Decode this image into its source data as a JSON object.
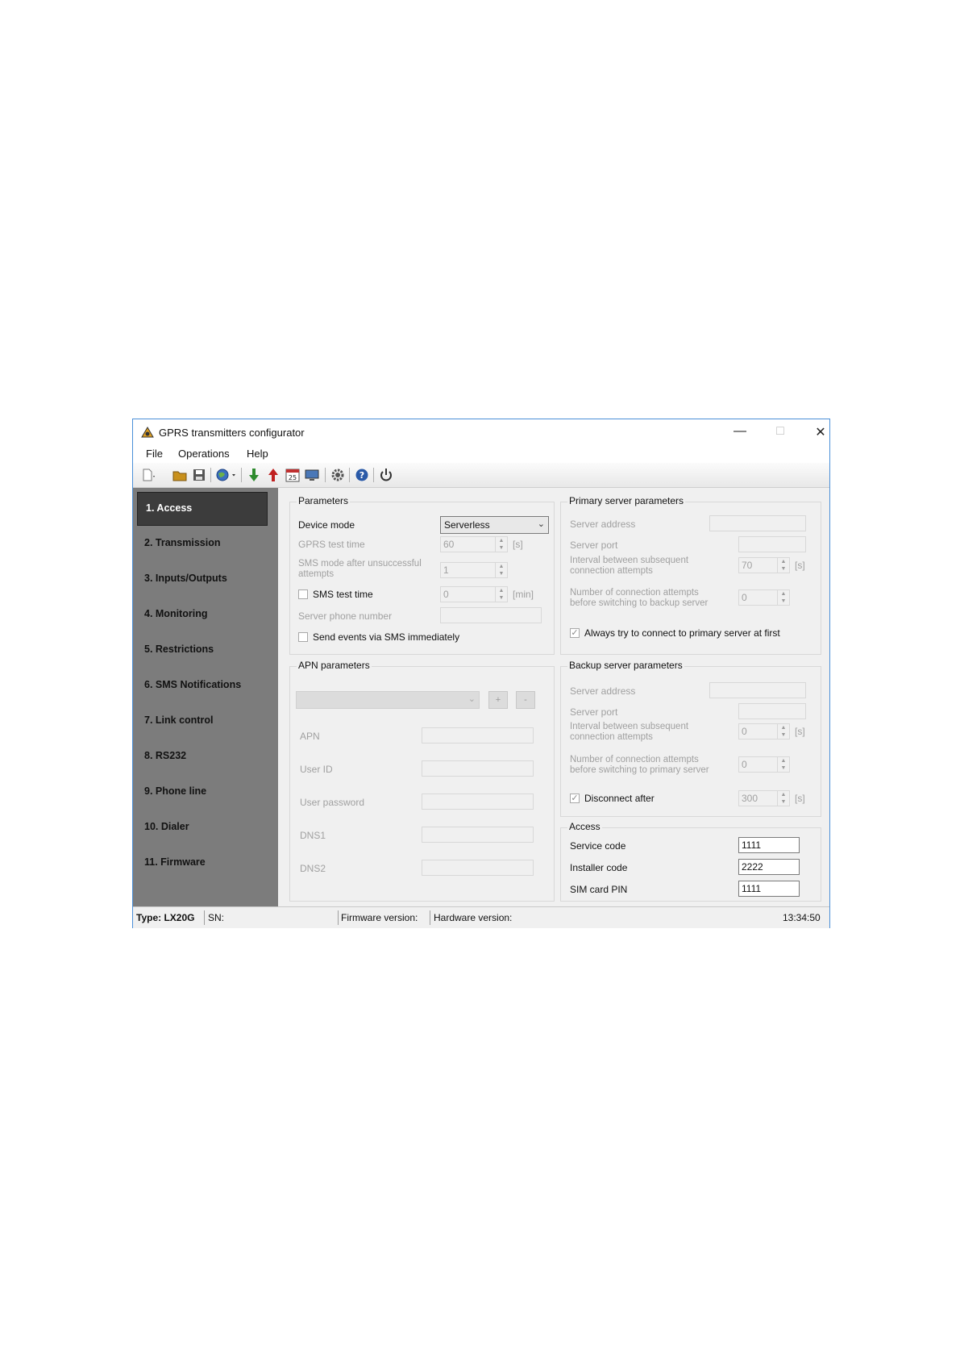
{
  "window": {
    "title": "GPRS transmitters configurator"
  },
  "menu": [
    "File",
    "Operations",
    "Help"
  ],
  "toolbar_icons": [
    "new-icon",
    "open-folder-icon",
    "save-icon",
    "globe-icon",
    "download-icon",
    "upload-icon",
    "calendar-icon",
    "monitor-icon",
    "gear-icon",
    "help-icon",
    "power-icon"
  ],
  "toolbar_calendar_day": "25",
  "sidebar": {
    "items": [
      "1. Access",
      "2. Transmission",
      "3. Inputs/Outputs",
      "4. Monitoring",
      "5. Restrictions",
      "6. SMS Notifications",
      "7. Link control",
      "8. RS232",
      "9. Phone line",
      "10. Dialer",
      "11. Firmware"
    ],
    "active": "1. Access"
  },
  "parameters": {
    "title": "Parameters",
    "device_mode_label": "Device mode",
    "device_mode_value": "Serverless",
    "gprs_test_time_label": "GPRS test time",
    "gprs_test_time_value": "60",
    "gprs_test_time_unit": "[s]",
    "sms_mode_label_1": "SMS mode after unsuccessful",
    "sms_mode_label_2": "attempts",
    "sms_mode_value": "1",
    "sms_test_time_label": "SMS test time",
    "sms_test_time_value": "0",
    "sms_test_time_unit": "[min]",
    "server_phone_label": "Server phone number",
    "server_phone_value": "",
    "send_events_label": "Send events via SMS immediately"
  },
  "apn": {
    "title": "APN parameters",
    "plus": "+",
    "minus": "-",
    "apn_label": "APN",
    "user_id_label": "User ID",
    "user_password_label": "User password",
    "dns1_label": "DNS1",
    "dns2_label": "DNS2"
  },
  "primary": {
    "title": "Primary server parameters",
    "server_address_label": "Server address",
    "server_port_label": "Server port",
    "interval_label_1": "Interval between subsequent",
    "interval_label_2": "connection attempts",
    "interval_value": "70",
    "interval_unit": "[s]",
    "attempts_label_1": "Number of connection attempts",
    "attempts_label_2": "before switching to backup server",
    "attempts_value": "0",
    "always_try_label": "Always try to connect to primary server at first"
  },
  "backup": {
    "title": "Backup server parameters",
    "server_address_label": "Server address",
    "server_port_label": "Server port",
    "interval_label_1": "Interval between subsequent",
    "interval_label_2": "connection attempts",
    "interval_value": "0",
    "interval_unit": "[s]",
    "attempts_label_1": "Number of connection attempts",
    "attempts_label_2": "before switching to primary server",
    "attempts_value": "0",
    "disconnect_label": "Disconnect after",
    "disconnect_value": "300",
    "disconnect_unit": "[s]"
  },
  "access": {
    "title": "Access",
    "service_code_label": "Service code",
    "service_code_value": "1111",
    "installer_code_label": "Installer code",
    "installer_code_value": "2222",
    "sim_pin_label": "SIM card PIN",
    "sim_pin_value": "1111"
  },
  "status": {
    "type": "Type: LX20G",
    "sn": "SN:",
    "firmware": "Firmware version:",
    "hardware": "Hardware version:",
    "time": "13:34:50"
  }
}
